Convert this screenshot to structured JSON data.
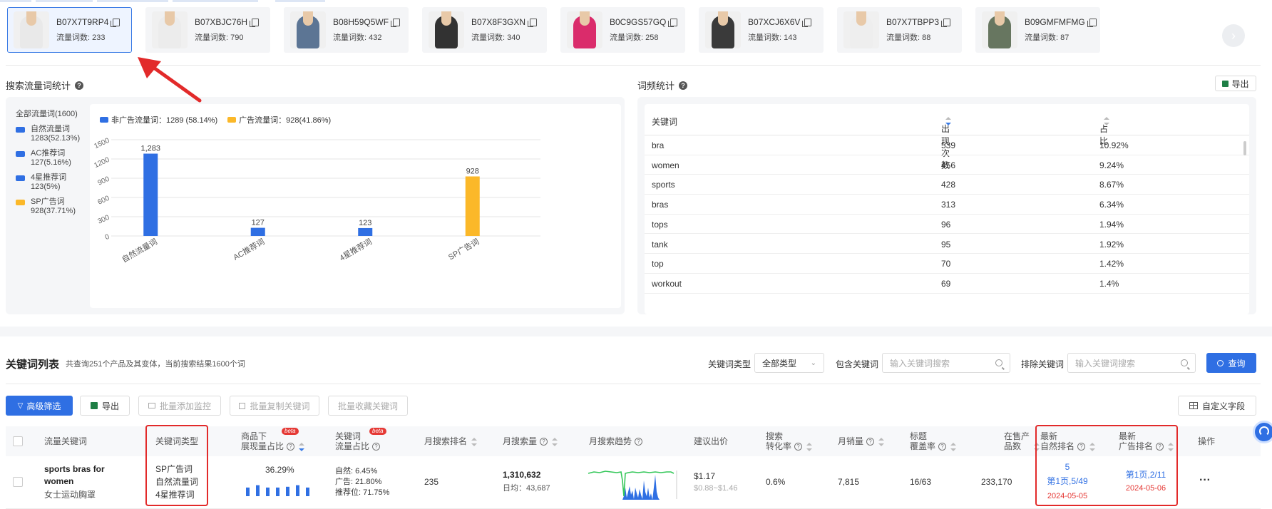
{
  "products": [
    {
      "asin": "B07X7T9RP4",
      "count_label": "流量词数: 233",
      "selected": true,
      "color": "#e8e8e8"
    },
    {
      "asin": "B07XBJC76H",
      "count_label": "流量词数: 790",
      "selected": false,
      "color": "#ececec"
    },
    {
      "asin": "B08H59Q5WF",
      "count_label": "流量词数: 432",
      "selected": false,
      "color": "#4f6a8c"
    },
    {
      "asin": "B07X8F3GXN",
      "count_label": "流量词数: 340",
      "selected": false,
      "color": "#222222"
    },
    {
      "asin": "B0C9GS57GQ",
      "count_label": "流量词数: 258",
      "selected": false,
      "color": "#d81b60"
    },
    {
      "asin": "B07XCJ6X6V",
      "count_label": "流量词数: 143",
      "selected": false,
      "color": "#2a2a2a"
    },
    {
      "asin": "B07X7TBPP3",
      "count_label": "流量词数: 88",
      "selected": false,
      "color": "#eeeeee"
    },
    {
      "asin": "B09GMFMFMG",
      "count_label": "流量词数: 87",
      "selected": false,
      "color": "#5b6b54"
    }
  ],
  "next_icon": "chevron-right-icon",
  "search_stats": {
    "title": "搜索流量词统计",
    "total": "全部流量词(1600)",
    "legend": [
      {
        "name": "自然流量词",
        "value": "1283(52.13%)",
        "color": "#2f6fe3"
      },
      {
        "name": "AC推荐词",
        "value": "127(5.16%)",
        "color": "#2f6fe3"
      },
      {
        "name": "4星推荐词",
        "value": "123(5%)",
        "color": "#2f6fe3"
      },
      {
        "name": "SP广告词",
        "value": "928(37.71%)",
        "color": "#fbb829"
      }
    ],
    "top_legend": [
      {
        "name": "非广告流量词：1289 (58.14%)",
        "color": "#2f6fe3"
      },
      {
        "name": "广告流量词：928(41.86%)",
        "color": "#fbb829"
      }
    ]
  },
  "chart_data": {
    "type": "bar",
    "categories": [
      "自然流量词",
      "AC推荐词",
      "4星推荐词",
      "SP广告词"
    ],
    "values": [
      1283,
      127,
      123,
      928
    ],
    "data_labels": [
      "1,283",
      "127",
      "123",
      "928"
    ],
    "colors": [
      "#2f6fe3",
      "#2f6fe3",
      "#2f6fe3",
      "#fbb829"
    ],
    "yticks": [
      0,
      300,
      600,
      900,
      1200,
      1500
    ],
    "ylim": [
      0,
      1500
    ],
    "grid": "horizontal"
  },
  "word_freq": {
    "title": "词频统计",
    "export_label": "导出",
    "headers": {
      "keyword": "关键词",
      "count": "出现次数",
      "ratio": "占比"
    },
    "rows": [
      {
        "keyword": "bra",
        "count": "539",
        "ratio": "10.92%"
      },
      {
        "keyword": "women",
        "count": "456",
        "ratio": "9.24%"
      },
      {
        "keyword": "sports",
        "count": "428",
        "ratio": "8.67%"
      },
      {
        "keyword": "bras",
        "count": "313",
        "ratio": "6.34%"
      },
      {
        "keyword": "tops",
        "count": "96",
        "ratio": "1.94%"
      },
      {
        "keyword": "tank",
        "count": "95",
        "ratio": "1.92%"
      },
      {
        "keyword": "top",
        "count": "70",
        "ratio": "1.42%"
      },
      {
        "keyword": "workout",
        "count": "69",
        "ratio": "1.4%"
      }
    ]
  },
  "keyword_list": {
    "title": "关键词列表",
    "summary": "共查询251个产品及其变体，当前搜索结果1600个词",
    "type_label": "关键词类型",
    "type_value": "全部类型",
    "include_label": "包含关键词",
    "include_placeholder": "输入关键词搜索",
    "exclude_label": "排除关键词",
    "exclude_placeholder": "输入关键词搜索",
    "query_label": "查询",
    "toolbar": {
      "advanced": "高级筛选",
      "export": "导出",
      "add_monitor": "批量添加监控",
      "copy_keywords": "批量复制关键词",
      "fav_keywords": "批量收藏关键词",
      "custom_fields": "自定义字段"
    },
    "headers": {
      "keyword": "流量关键词",
      "type": "关键词类型",
      "share1": "商品下",
      "share2": "展现量占比",
      "flow1": "关键词",
      "flow2": "流量占比",
      "rank": "月搜索排名",
      "volume": "月搜索量",
      "trend": "月搜索趋势",
      "bid": "建议出价",
      "conv1": "搜索",
      "conv2": "转化率",
      "sales": "月销量",
      "cover1": "标题",
      "cover2": "覆盖率",
      "products1": "在售产",
      "products2": "品数",
      "natrank1": "最新",
      "natrank2": "自然排名",
      "adrank1": "最新",
      "adrank2": "广告排名",
      "ops": "操作",
      "beta": "beta"
    },
    "row": {
      "keyword": "sports bras for women",
      "keyword_cn": "女士运动胸罩",
      "types": [
        "SP广告词",
        "自然流量词",
        "4星推荐词"
      ],
      "share": "36.29%",
      "share_bars": [
        0.55,
        0.7,
        0.55,
        0.55,
        0.6,
        0.7,
        0.55
      ],
      "flow_natural": "自然: 6.45%",
      "flow_ad": "广告: 21.80%",
      "flow_rec": "推荐位: 71.75%",
      "rank": "235",
      "volume": "1,310,632",
      "daily": "日均：43,687",
      "bid": "$1.17",
      "bid_range": "$0.88~$1.46",
      "conv": "0.6%",
      "sales": "7,815",
      "cover": "16/63",
      "products": "233,170",
      "nat_rank": "5",
      "nat_page": "第1页,5/49",
      "nat_date": "2024-05-05",
      "ad_page": "第1页,2/11",
      "ad_date": "2024-05-06",
      "ops": "···"
    }
  }
}
